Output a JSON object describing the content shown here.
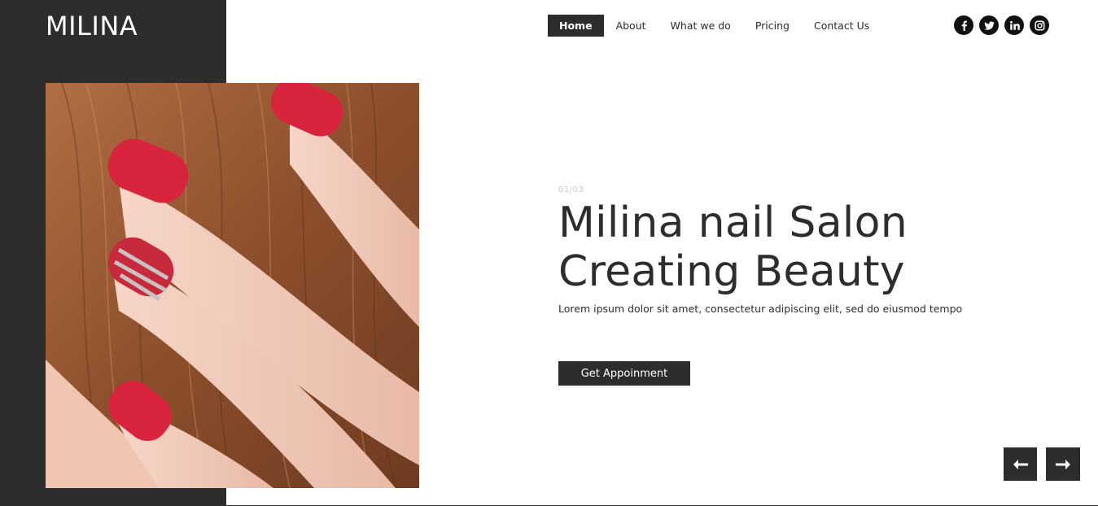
{
  "brand": {
    "logo_text": "MILINA"
  },
  "nav": {
    "items": [
      {
        "label": "Home",
        "active": true
      },
      {
        "label": "About"
      },
      {
        "label": "What we do"
      },
      {
        "label": "Pricing"
      },
      {
        "label": "Contact Us"
      }
    ]
  },
  "social": [
    "facebook-icon",
    "twitter-icon",
    "linkedin-icon",
    "instagram-icon"
  ],
  "hero": {
    "counter": "01/03",
    "headline_line1": "Milina nail Salon",
    "headline_line2": "Creating Beauty",
    "lead": "Lorem ipsum dolor sit amet, consectetur adipiscing elit, sed do eiusmod tempo",
    "cta_label": "Get Appoinment",
    "image_alt": "hand with red painted nails in hair"
  },
  "slider": {
    "prev_icon": "arrow-left-icon",
    "next_icon": "arrow-right-icon"
  },
  "colors": {
    "dark": "#2d2d2d",
    "nail_red": "#d8243c",
    "hair_brown": "#9a5a34",
    "skin": "#f2cfc0"
  }
}
